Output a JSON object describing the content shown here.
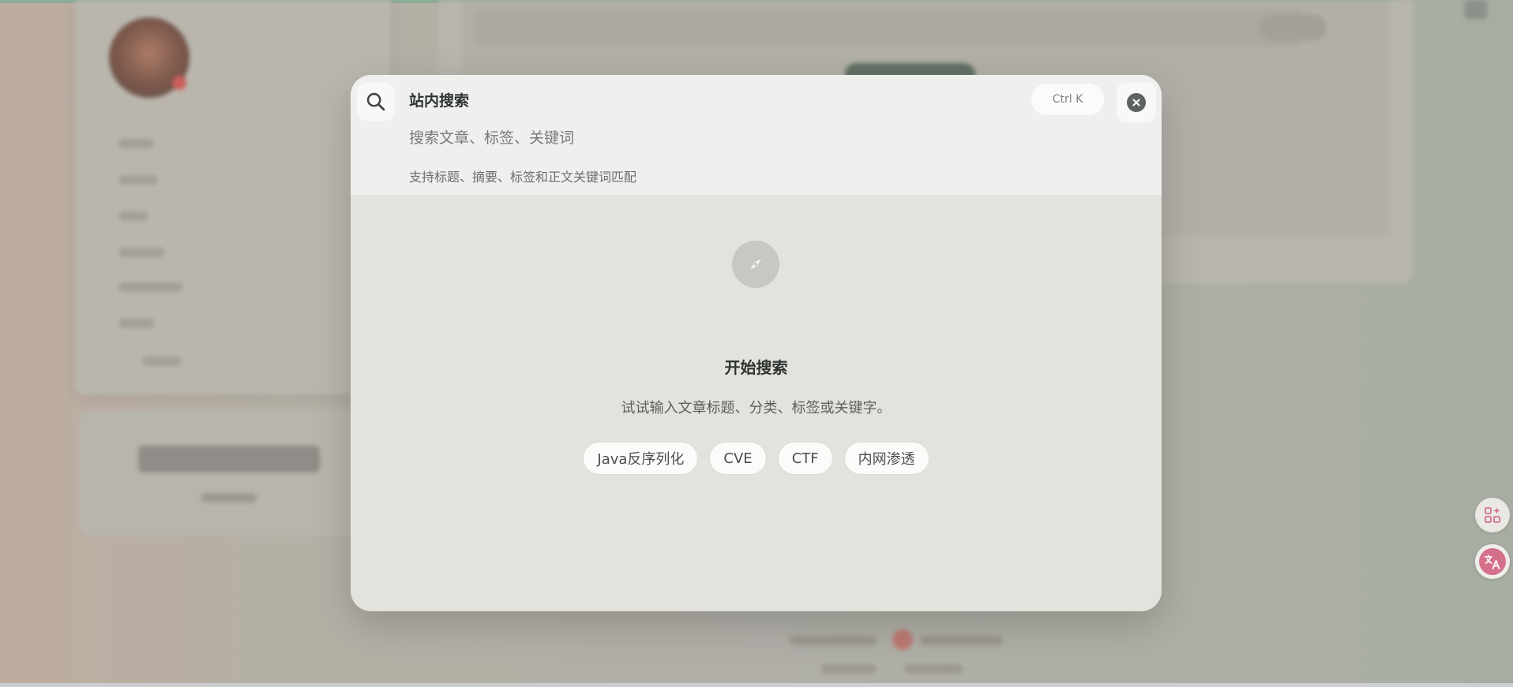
{
  "search_modal": {
    "title": "站内搜索",
    "input": {
      "value": "",
      "placeholder": "搜索文章、标签、关键词"
    },
    "hint": "支持标题、摘要、标签和正文关键词匹配",
    "shortcut": "Ctrl K",
    "empty_state": {
      "title": "开始搜索",
      "description": "试试输入文章标题、分类、标签或关键字。"
    },
    "suggestions": [
      {
        "label": "Java反序列化"
      },
      {
        "label": "CVE"
      },
      {
        "label": "CTF"
      },
      {
        "label": "内网渗透"
      }
    ]
  },
  "icons": {
    "search": "search-icon",
    "close": "close-icon",
    "compass": "compass-icon",
    "apps": "apps-sparkle-icon",
    "translate": "translate-icon"
  },
  "colors": {
    "modal_background": "#e4e2dc",
    "header_background": "#efefee",
    "title_text": "#2e3431",
    "close_button": "#5c635f",
    "translate_accent": "#d5708b",
    "top_bar": "#8fb39b"
  }
}
